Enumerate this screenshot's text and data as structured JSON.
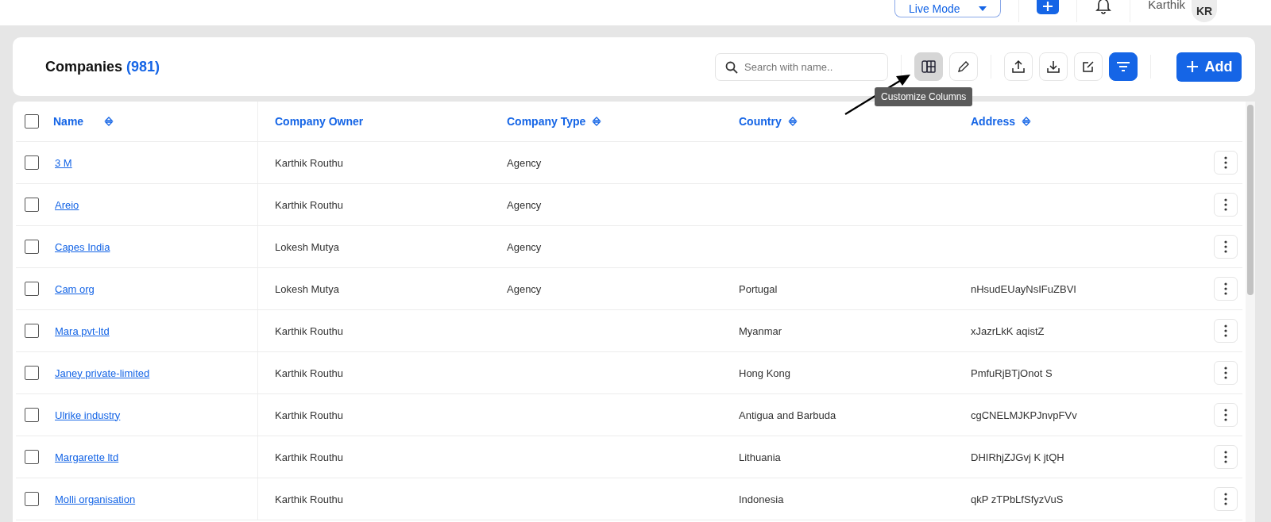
{
  "top_bar": {
    "mode_dropdown": "Live Mode",
    "user_name": "Karthik",
    "avatar_initials": "KR"
  },
  "header": {
    "title": "Companies",
    "count": "(981)",
    "search": {
      "placeholder": "Search with name.."
    },
    "add_button": "Add",
    "filter_active": true,
    "columns_button_active": true,
    "tooltip": "Customize Columns"
  },
  "table": {
    "all_checked": false,
    "columns": [
      {
        "label": "Name",
        "sortable": true
      },
      {
        "label": "Company Owner",
        "sortable": false
      },
      {
        "label": "Company Type",
        "sortable": true
      },
      {
        "label": "Country",
        "sortable": true
      },
      {
        "label": "Address",
        "sortable": true
      }
    ],
    "rows": [
      {
        "checked": false,
        "name": "3 M",
        "owner": "Karthik Routhu",
        "type": "Agency",
        "country": "",
        "address": ""
      },
      {
        "checked": false,
        "name": "Areio",
        "owner": "Karthik Routhu",
        "type": "Agency",
        "country": "",
        "address": ""
      },
      {
        "checked": false,
        "name": "Capes India",
        "owner": "Lokesh Mutya",
        "type": "Agency",
        "country": "",
        "address": ""
      },
      {
        "checked": false,
        "name": "Cam org",
        "owner": "Lokesh Mutya",
        "type": "Agency",
        "country": "Portugal",
        "address": "nHsudEUayNsIFuZBVI"
      },
      {
        "checked": false,
        "name": "Mara pvt-ltd",
        "owner": "Karthik Routhu",
        "type": "",
        "country": "Myanmar",
        "address": "xJazrLkK aqistZ"
      },
      {
        "checked": false,
        "name": "Janey private-limited",
        "owner": "Karthik Routhu",
        "type": "",
        "country": "Hong Kong",
        "address": "PmfuRjBTjOnot S"
      },
      {
        "checked": false,
        "name": "Ulrike industry",
        "owner": "Karthik Routhu",
        "type": "",
        "country": "Antigua and Barbuda",
        "address": "cgCNELMJKPJnvpFVv"
      },
      {
        "checked": false,
        "name": "Margarette ltd",
        "owner": "Karthik Routhu",
        "type": "",
        "country": "Lithuania",
        "address": "DHIRhjZJGvj K jtQH"
      },
      {
        "checked": false,
        "name": "Molli organisation",
        "owner": "Karthik Routhu",
        "type": "",
        "country": "Indonesia",
        "address": "qkP zTPbLfSfyzVuS"
      }
    ]
  }
}
